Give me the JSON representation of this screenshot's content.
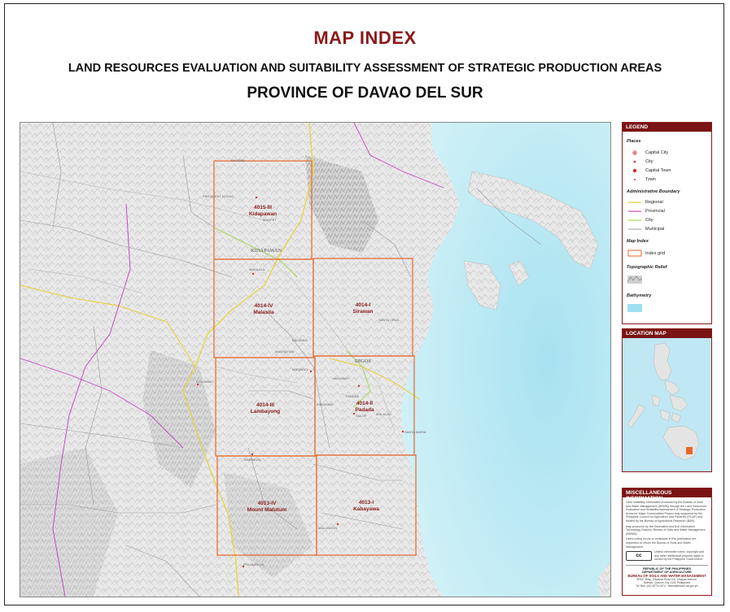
{
  "titles": {
    "main": "MAP INDEX",
    "sub": "LAND RESOURCES EVALUATION AND SUITABILITY ASSESSMENT OF STRATEGIC PRODUCTION AREAS",
    "province": "PROVINCE OF DAVAO DEL SUR"
  },
  "grid_tiles": [
    {
      "code": "4015-III",
      "name": "Kidapawan"
    },
    {
      "code": "4014-IV",
      "name": "Malasila"
    },
    {
      "code": "4014-I",
      "name": "Sirawan"
    },
    {
      "code": "4014-III",
      "name": "Lambayong"
    },
    {
      "code": "4014-II",
      "name": "Padada"
    },
    {
      "code": "4013-IV",
      "name": "Mount Matutum"
    },
    {
      "code": "4013-I",
      "name": "Kabayawa"
    }
  ],
  "place_labels": {
    "antipas": "ANTIPAS",
    "president_roxas": "PRESIDENT ROXAS",
    "magpet": "MAGPET",
    "kidapawan": "KIDAPAWAN",
    "makilala": "MAKILALA",
    "santa_cruz": "SANTA CRUZ",
    "bansalan": "BALABAG",
    "magsaysay": "MAGSAYSAY",
    "digos": "DIGOS",
    "matanao": "MATANAO",
    "hagonoy": "HAGONOY",
    "padada": "PADADA",
    "kiblawan": "KIBLAWAN",
    "sulop": "SULOP",
    "malalag": "MALALAG",
    "santa_maria": "SANTA MARIA",
    "columbio": "COLUMBIO",
    "tampakan": "TAMPAKAN",
    "malungon": "MALUNGON",
    "polomolok": "POLOMOLOK"
  },
  "legend": {
    "header": "LEGEND",
    "places_title": "Places",
    "places": [
      "Capital City",
      "City",
      "Capital Town",
      "Town"
    ],
    "admin_title": "Administrative Boundary",
    "admin": [
      "Regional",
      "Provincial",
      "City",
      "Municipal"
    ],
    "admin_colors": [
      "#e8d44a",
      "#c848c8",
      "#a8d858",
      "#9a9a9a"
    ],
    "mapindex_title": "Map Index",
    "mapindex_item": "Index grid",
    "relief_title": "Topographic Relief",
    "bathy_title": "Bathymetry"
  },
  "location_map": {
    "header": "LOCATION MAP"
  },
  "misc": {
    "header": "MISCELLANEOUS INFORMATION",
    "p1": "Land suitability information produced by the Bureau of Soils and Water Management (BSWM) through the Land Resources Evaluation and Suitability Assessment of Strategic Production Areas for Major Commodities Project duly supported by the Philippine Council for Agriculture and Fisheries (PCAF) and funded by the Bureau of Agricultural Research (BAR).",
    "p2": "Map produced by the Geomatics and Soil Information Technology Division, Bureau of Soils and Water Management (BSWM).",
    "p3": "Users noting errors or omissions in this publication are requested to inform the Bureau of Soils and Water Management.",
    "p4": "Unless otherwise noted, copyright and any other intellectual property rights is owned by the Philippine Government.",
    "agency1": "REPUBLIC OF THE PHILIPPINES",
    "agency2": "DEPARTMENT OF AGRICULTURE",
    "agency3": "BUREAU OF SOILS AND WATER MANAGEMENT",
    "address1": "SRDC Bldg., Elliptical Road Cor. Visayas Avenue,",
    "address2": "Diliman, Quezon City 1100 Philippines",
    "contact": "Tel Nos: (02) 8273-2474 · bswm@bswm.da.gov.ph",
    "cc_badge": "cc"
  },
  "colors": {
    "title_red": "#8b1a1a",
    "grid_orange": "#e8662a",
    "sea": "#bfeaf4",
    "land": "#eeeeee"
  }
}
